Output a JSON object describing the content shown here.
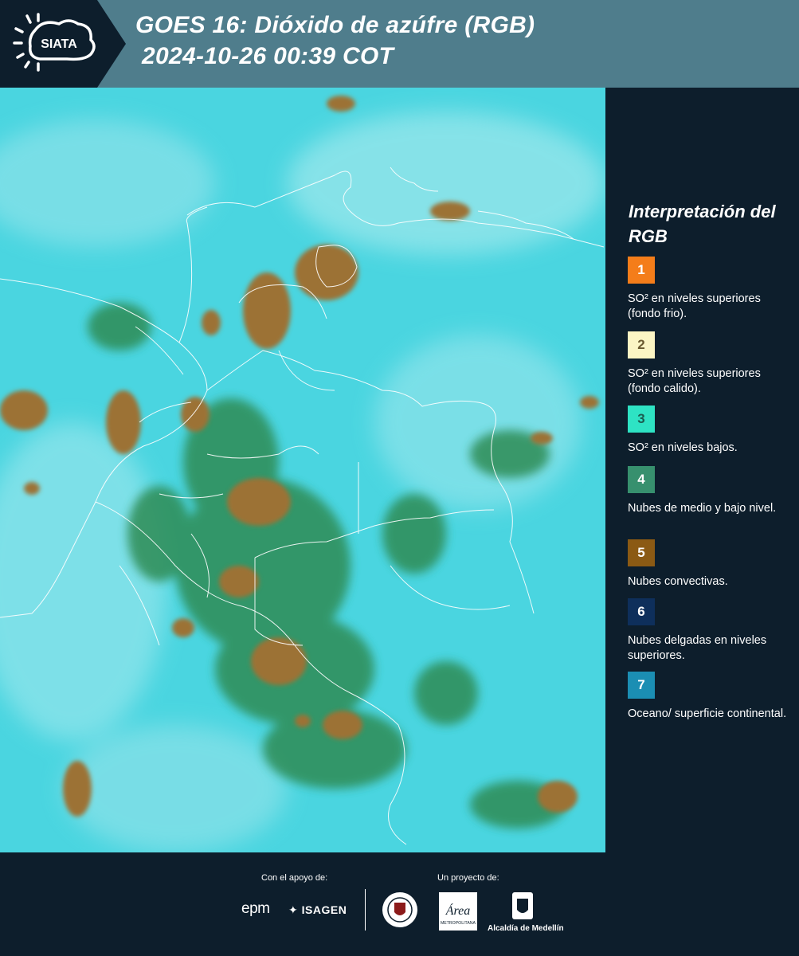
{
  "header": {
    "logo_text": "SIATA",
    "title_line1": "GOES 16: Dióxido de azúfre (RGB)",
    "title_line2": "2024-10-26 00:39 COT"
  },
  "legend": {
    "title": "Interpretación del RGB",
    "items": [
      {
        "number": "1",
        "label": "SO² en niveles superiores (fondo frio).",
        "color": "#f47d1a"
      },
      {
        "number": "2",
        "label": "SO² en niveles superiores (fondo calido).",
        "color": "#fbf5c4"
      },
      {
        "number": "3",
        "label": "SO² en niveles bajos.",
        "color": "#2ee3c4"
      },
      {
        "number": "4",
        "label": "Nubes de medio y bajo nivel.",
        "color": "#37906e"
      },
      {
        "number": "5",
        "label": "Nubes convectivas.",
        "color": "#8b5a14"
      },
      {
        "number": "6",
        "label": "Nubes delgadas en niveles superiores.",
        "color": "#0e2f5b"
      },
      {
        "number": "7",
        "label": "Oceano/ superficie continental.",
        "color": "#1b8eb3"
      }
    ]
  },
  "footer": {
    "support_label": "Con el apoyo de:",
    "project_label": "Un proyecto de:",
    "epm": "epm",
    "isagen": "ISAGEN",
    "alcaldia": "Alcaldía de Medellín",
    "area_logo_text": "Área",
    "area_logo_subtext": "METROPOLITANA"
  },
  "colors": {
    "header_bg": "#4f7d8c",
    "dark_bg": "#0d1e2c",
    "map_cyan": "#4ad5e0",
    "cloud_green": "#2e8a52",
    "cloud_brown": "#9c7234"
  }
}
